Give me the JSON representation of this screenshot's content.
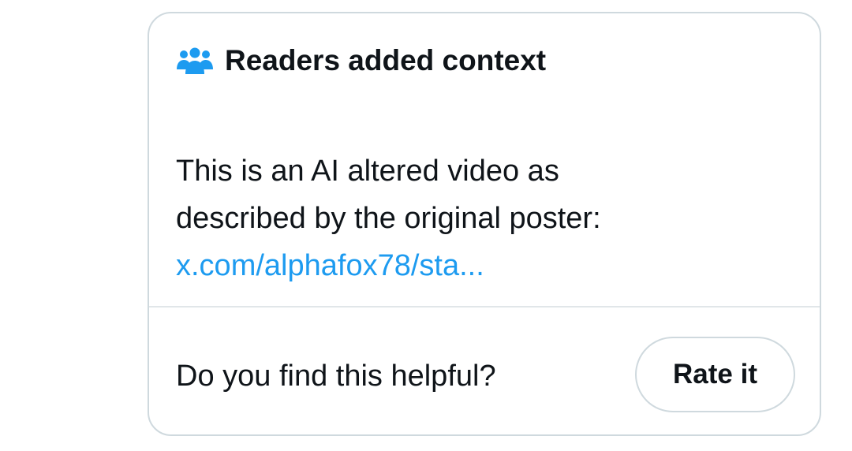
{
  "note_header": {
    "icon": "people-group-icon",
    "icon_color": "#1d9bf0",
    "title": "Readers added context"
  },
  "note_body": {
    "line1": "This is an AI altered video as",
    "line2": "described by the original poster:",
    "link_text": "x.com/alphafox78/sta..."
  },
  "feedback": {
    "question": "Do you find this helpful?",
    "rate_button_label": "Rate it"
  },
  "colors": {
    "text": "#0f1419",
    "link": "#1d9bf0",
    "border": "#cfd9de"
  }
}
